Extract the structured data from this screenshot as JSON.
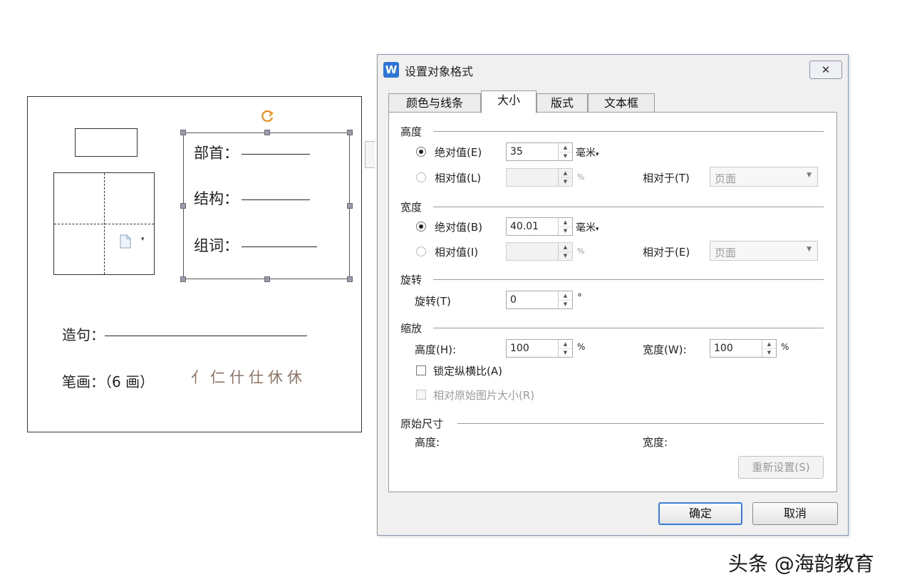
{
  "document": {
    "radical_label": "部首：",
    "structure_label": "结构：",
    "word_label": "组词：",
    "sentence_label": "造句：",
    "strokes_label": "笔画：（6 画）",
    "stroke_steps": [
      "亻",
      "仁",
      "什",
      "仕",
      "休",
      "休"
    ]
  },
  "dialog": {
    "title": "设置对象格式",
    "close": "✕",
    "tabs": [
      "颜色与线条",
      "大小",
      "版式",
      "文本框"
    ],
    "height_section": {
      "label": "高度",
      "absolute_label": "绝对值(E)",
      "absolute_value": "35",
      "absolute_unit": "毫米",
      "relative_label": "相对值(L)",
      "relative_value": "",
      "relative_unit": "%",
      "relative_to_label": "相对于(T)",
      "relative_to_value": "页面"
    },
    "width_section": {
      "label": "宽度",
      "absolute_label": "绝对值(B)",
      "absolute_value": "40.01",
      "absolute_unit": "毫米",
      "relative_label": "相对值(I)",
      "relative_value": "",
      "relative_unit": "%",
      "relative_to_label": "相对于(E)",
      "relative_to_value": "页面"
    },
    "rotation_section": {
      "label": "旋转",
      "rotate_label": "旋转(T)",
      "rotate_value": "0",
      "rotate_unit": "°"
    },
    "scale_section": {
      "label": "缩放",
      "height_label": "高度(H):",
      "height_value": "100",
      "height_unit": "%",
      "width_label": "宽度(W):",
      "width_value": "100",
      "width_unit": "%",
      "lock_label": "锁定纵横比(A)",
      "relative_original_label": "相对原始图片大小(R)"
    },
    "original_section": {
      "label": "原始尺寸",
      "height_label": "高度:",
      "width_label": "宽度:",
      "reset_label": "重新设置(S)"
    },
    "ok_label": "确定",
    "cancel_label": "取消"
  },
  "watermark": "头条 @海韵教育"
}
